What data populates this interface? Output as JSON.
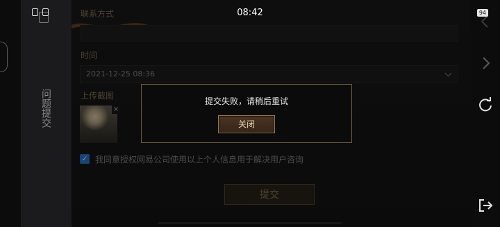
{
  "status_bar": {
    "time": "08:42",
    "battery": "94"
  },
  "side": {
    "vertical_title": "问题提交"
  },
  "form": {
    "contact_label": "联系方式",
    "time_label": "时间",
    "time_value": "2021-12-25 08:36",
    "screenshot_label": "上传截图",
    "consent_text": "我同意授权网易公司使用以上个人信息用于解决用户咨询",
    "submit_label": "提交",
    "thumb_close": "×"
  },
  "dialog": {
    "message": "提交失败，请稍后重试",
    "close_label": "关闭"
  },
  "colors": {
    "accent_gold": "#9a7a4e",
    "checkbox_blue": "#2a7ad4"
  },
  "icons": [
    "back-chevron-icon",
    "forward-chevron-icon",
    "refresh-icon",
    "exit-icon"
  ]
}
